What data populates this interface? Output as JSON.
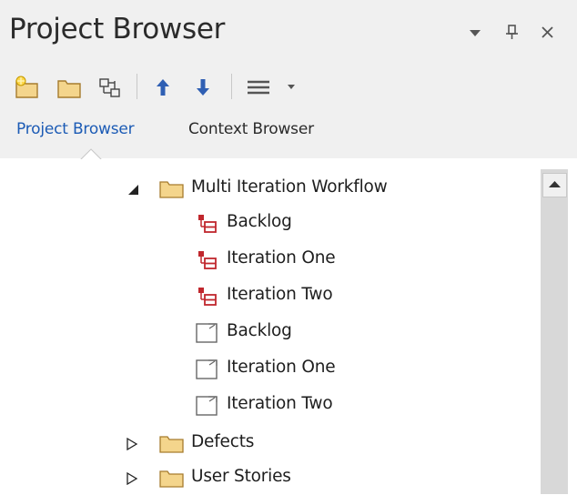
{
  "panel": {
    "title": "Project Browser"
  },
  "window_controls": {
    "menu_icon": "dropdown-arrow-icon",
    "pin_icon": "pin-icon",
    "close_icon": "close-icon"
  },
  "toolbar": {
    "buttons": [
      {
        "name": "new-package-icon"
      },
      {
        "name": "folder-icon"
      },
      {
        "name": "new-diagram-icon"
      },
      {
        "name": "move-up-icon"
      },
      {
        "name": "move-down-icon"
      },
      {
        "name": "menu-icon"
      }
    ]
  },
  "tabs": [
    {
      "label": "Project Browser",
      "active": true
    },
    {
      "label": "Context Browser",
      "active": false
    }
  ],
  "tree": {
    "root": {
      "label": "Multi Iteration Workflow",
      "expanded": true
    },
    "children": [
      {
        "label": "Backlog",
        "type": "element"
      },
      {
        "label": "Iteration One",
        "type": "element"
      },
      {
        "label": "Iteration Two",
        "type": "element"
      },
      {
        "label": "Backlog",
        "type": "diagram"
      },
      {
        "label": "Iteration One",
        "type": "diagram"
      },
      {
        "label": "Iteration Two",
        "type": "diagram"
      }
    ],
    "siblings": [
      {
        "label": "Defects",
        "expanded": false
      },
      {
        "label": "User Stories",
        "expanded": false
      }
    ]
  },
  "colors": {
    "accent": "#1c5bb5",
    "folder": "#f4d58c",
    "element_icon": "#c0272d",
    "arrow": "#2f5fb3"
  }
}
